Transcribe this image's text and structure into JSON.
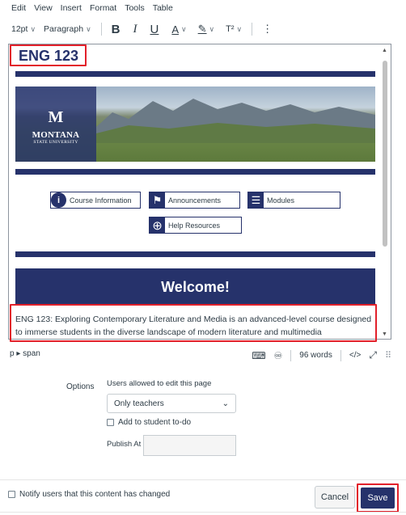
{
  "menu": [
    "Edit",
    "View",
    "Insert",
    "Format",
    "Tools",
    "Table"
  ],
  "toolbar": {
    "font_size": "12pt",
    "block_format": "Paragraph",
    "bold": "B",
    "italic": "I",
    "underline": "U",
    "text_color": "A",
    "highlight": "✎",
    "superscript": "T²",
    "more": "⋮"
  },
  "editor": {
    "heading": "ENG 123",
    "logo": {
      "m": "M",
      "name": "MONTANA",
      "sub": "STATE UNIVERSITY"
    },
    "nav_buttons": [
      {
        "label": "Course Information",
        "icon": "i"
      },
      {
        "label": "Announcements",
        "icon": "⚑"
      },
      {
        "label": "Modules",
        "icon": "☰"
      },
      {
        "label": "Help Resources",
        "icon": "⊕"
      }
    ],
    "welcome": "Welcome!",
    "paragraph": "ENG 123: Exploring Contemporary Literature and Media is an advanced-level course designed to immerse students in the diverse landscape of modern literature and multimedia"
  },
  "status": {
    "path": "p ▸ span",
    "word_count": "96 words",
    "html_toggle": "</>"
  },
  "options": {
    "label": "Options",
    "help": "Users allowed to edit this page",
    "selected": "Only teachers",
    "todo_label": "Add to student to-do",
    "publish_label": "Publish At"
  },
  "footer": {
    "notify_label": "Notify users that this content has changed",
    "cancel": "Cancel",
    "save": "Save"
  },
  "colors": {
    "brand": "#26326b",
    "highlight_box": "#e2202a"
  }
}
